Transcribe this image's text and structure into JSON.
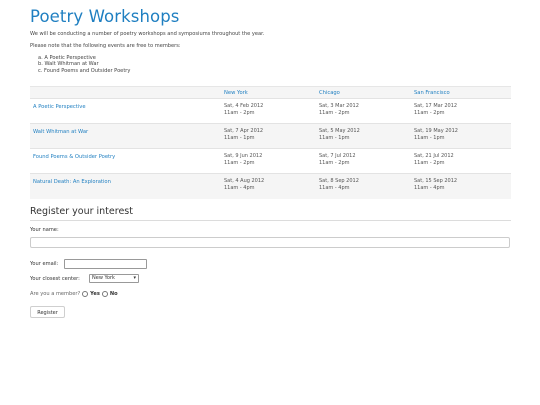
{
  "page": {
    "title": "Poetry Workshops",
    "intro": "We will be conducting a number of poetry workshops and symposiums throughout the year.",
    "note": "Please note that the following events are free to members:",
    "member_events": [
      "a. A Poetic Perspective",
      "b. Walt Whitman at War",
      "c. Found Poems and Outsider Poetry"
    ]
  },
  "schedule": {
    "columns": [
      "",
      "New York",
      "Chicago",
      "San Francisco"
    ],
    "rows": [
      {
        "event": "A Poetic Perspective",
        "cells": [
          {
            "date": "Sat, 4 Feb 2012",
            "time": "11am - 2pm"
          },
          {
            "date": "Sat, 3 Mar 2012",
            "time": "11am - 2pm"
          },
          {
            "date": "Sat, 17 Mar 2012",
            "time": "11am - 2pm"
          }
        ]
      },
      {
        "event": "Walt Whitman at War",
        "cells": [
          {
            "date": "Sat, 7 Apr 2012",
            "time": "11am - 1pm"
          },
          {
            "date": "Sat, 5 May 2012",
            "time": "11am - 1pm"
          },
          {
            "date": "Sat, 19 May 2012",
            "time": "11am - 1pm"
          }
        ]
      },
      {
        "event": "Found Poems & Outsider Poetry",
        "cells": [
          {
            "date": "Sat, 9 Jun 2012",
            "time": "11am - 2pm"
          },
          {
            "date": "Sat, 7 Jul 2012",
            "time": "11am - 2pm"
          },
          {
            "date": "Sat, 21 Jul 2012",
            "time": "11am - 2pm"
          }
        ]
      },
      {
        "event": "Natural Death: An Exploration",
        "cells": [
          {
            "date": "Sat, 4 Aug 2012",
            "time": "11am - 4pm"
          },
          {
            "date": "Sat, 8 Sep 2012",
            "time": "11am - 4pm"
          },
          {
            "date": "Sat, 15 Sep 2012",
            "time": "11am - 4pm"
          }
        ]
      }
    ]
  },
  "register": {
    "heading": "Register your interest",
    "name_label": "Your name:",
    "name_value": "",
    "email_label": "Your email:",
    "email_value": "",
    "center_label": "Your closest center:",
    "center_selected": "New York",
    "member_question": "Are you a member?",
    "member_yes": "Yes",
    "member_no": "No",
    "submit_label": "Register"
  },
  "colors": {
    "accent": "#1f7fc1",
    "row_shade": "#f5f5f5"
  },
  "icons": {
    "select_arrow": "chevron-down-icon",
    "radio": "radio-button-icon"
  }
}
